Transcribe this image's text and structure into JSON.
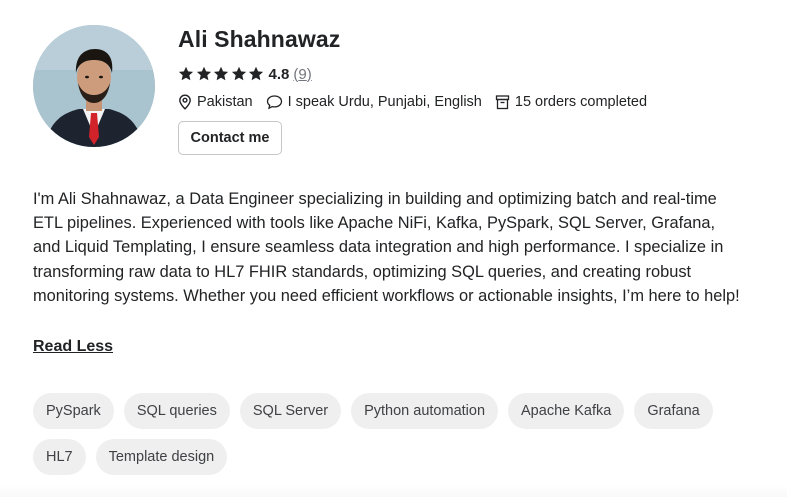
{
  "profile": {
    "name": "Ali Shahnawaz",
    "rating": "4.8",
    "rating_count": "9",
    "rating_stars": 5,
    "location": "Pakistan",
    "languages": "I speak Urdu, Punjabi, English",
    "orders": "15 orders completed",
    "contact_label": "Contact me"
  },
  "bio": {
    "text": "I'm Ali Shahnawaz, a Data Engineer specializing in building and optimizing batch and real-time ETL pipelines. Experienced with tools like Apache NiFi, Kafka, PySpark, SQL Server, Grafana, and Liquid Templating, I ensure seamless data integration and high performance. I specialize in transforming raw data to HL7 FHIR standards, optimizing SQL queries, and creating robust monitoring systems. Whether you need efficient workflows or actionable insights, I’m here to help!",
    "read_less_label": "Read Less"
  },
  "skills": [
    "PySpark",
    "SQL queries",
    "SQL Server",
    "Python automation",
    "Apache Kafka",
    "Grafana",
    "HL7",
    "Template design"
  ],
  "icons": {
    "star": "star-icon",
    "location": "location-pin-icon",
    "languages": "speech-bubble-icon",
    "orders": "orders-box-icon"
  },
  "colors": {
    "text": "#222325",
    "muted": "#74767e",
    "chip_bg": "#efefef",
    "border": "#c5c6c9"
  }
}
